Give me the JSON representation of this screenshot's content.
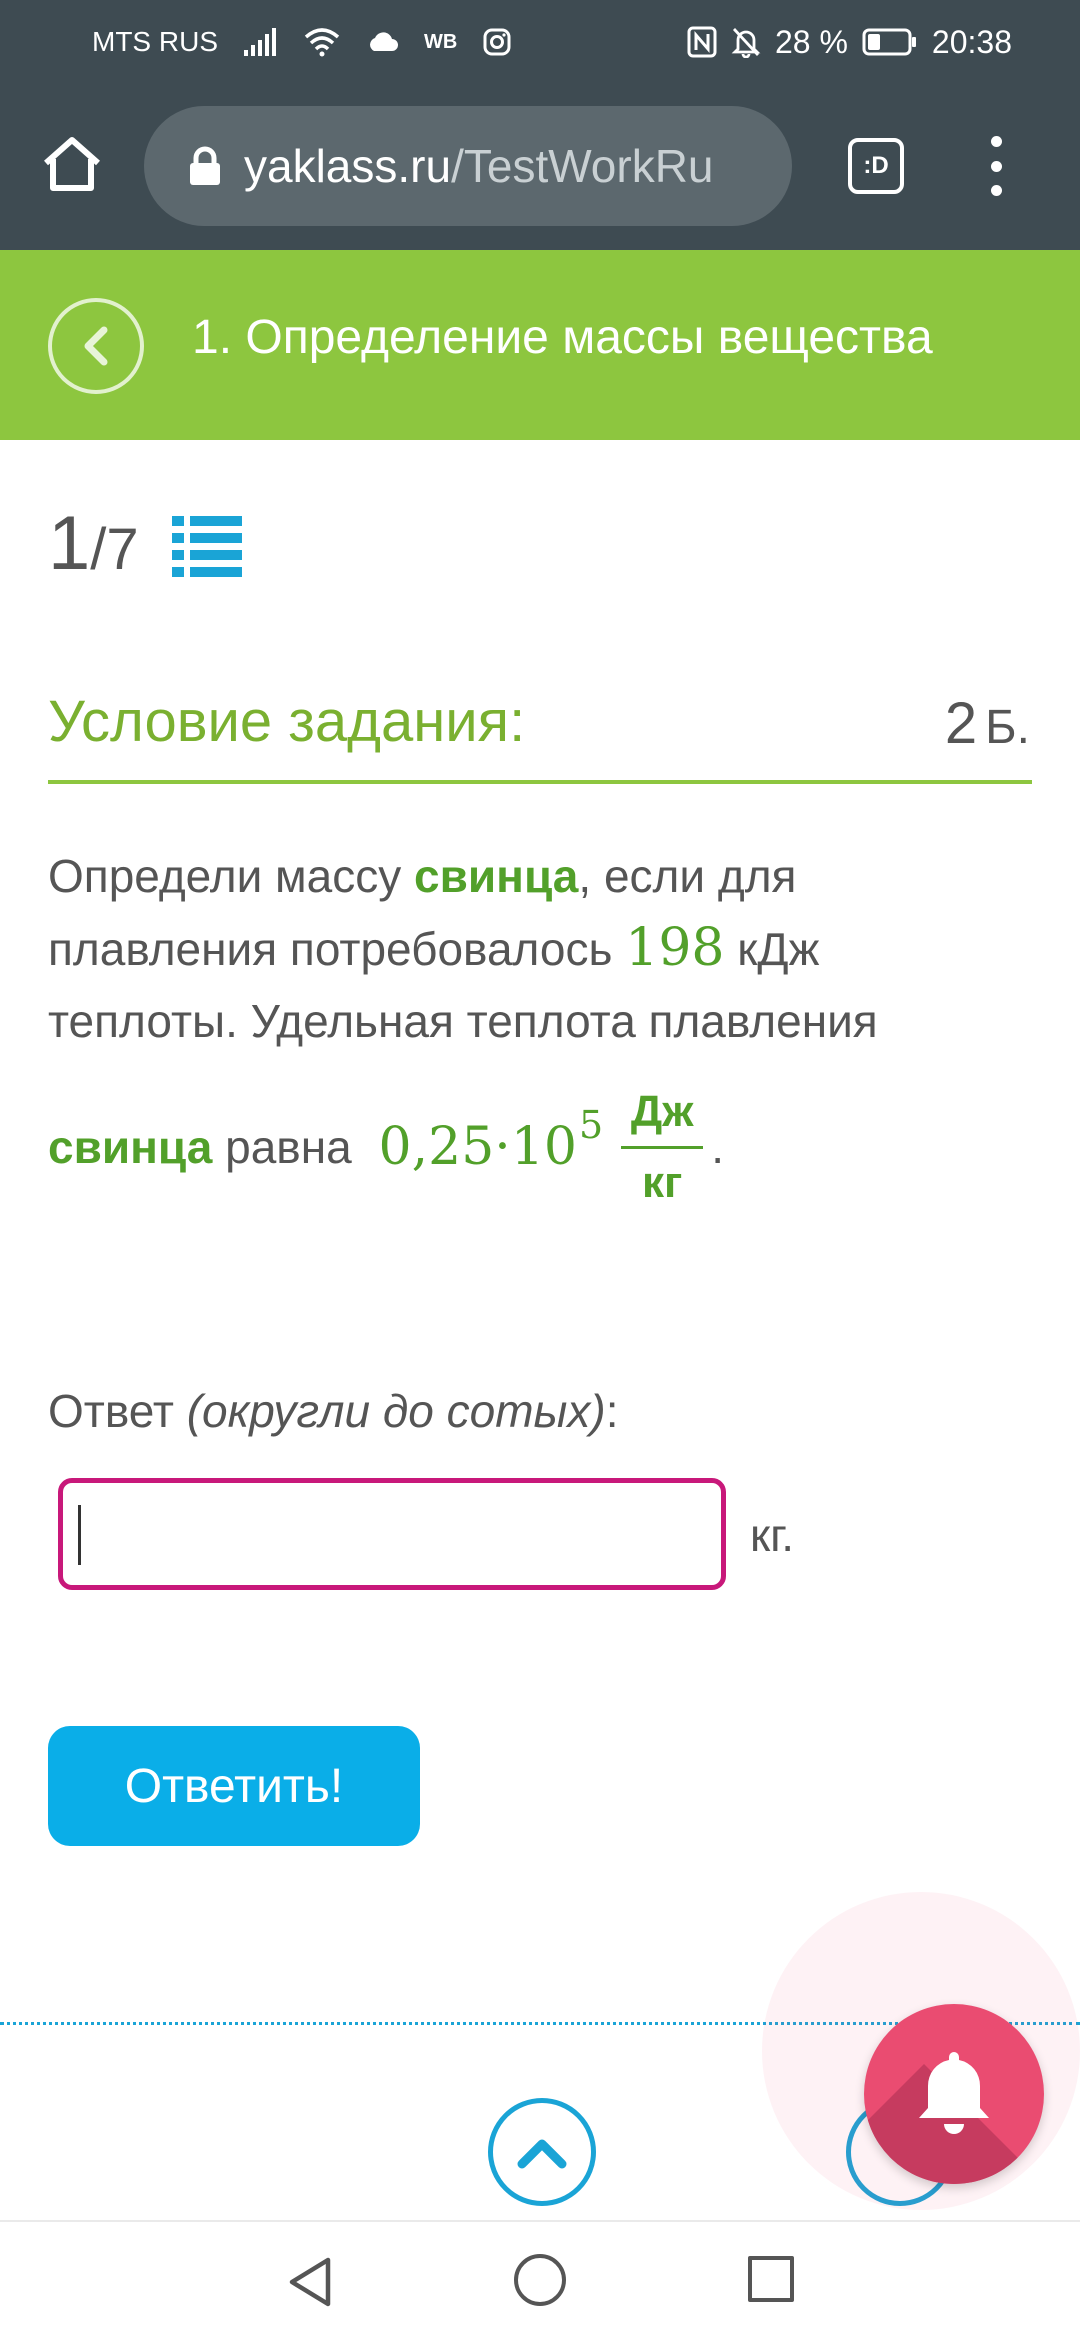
{
  "status_bar": {
    "carrier": "MTS RUS",
    "wb": "WB",
    "battery": "28 %",
    "time": "20:38",
    "icons": [
      "signal-icon",
      "wifi-icon",
      "cloud-icon",
      "instagram-icon",
      "nfc-icon",
      "mute-bell-icon",
      "battery-icon"
    ]
  },
  "browser": {
    "url_host": "yaklass.ru",
    "url_path": "/TestWorkRu",
    "tabs_label": ":D",
    "icons": [
      "home-icon",
      "lock-icon",
      "more-vert-icon"
    ]
  },
  "header": {
    "title": "1. Определение массы вещества",
    "back_icon": "chevron-left-icon",
    "color": "#8dc63f"
  },
  "counter": {
    "current": "1",
    "separator": "/",
    "total": "7",
    "icon": "list-icon"
  },
  "condition": {
    "title": "Условие задания:",
    "points": "2",
    "points_unit": "Б."
  },
  "problem": {
    "p1": "Определи массу ",
    "substance1": "свинца",
    "p2": ", если для плавления потребовалось ",
    "energy": "198",
    "p3": " кДж теплоты. Удельная теплота плавления",
    "substance2": "свинца",
    "p4": " равна ",
    "coef": "0,25·10",
    "exponent": "5",
    "frac_num": "Дж",
    "frac_den": "кг",
    "period": "."
  },
  "answer": {
    "label": "Ответ ",
    "hint": "(округли до сотых)",
    "colon": ":",
    "value": "",
    "unit": "кг."
  },
  "submit_label": "Ответить!",
  "fab": {
    "icon": "bell-icon",
    "color": "#ea4c71"
  },
  "scroll_up_icon": "chevron-up-icon",
  "nav": {
    "icons": [
      "nav-back-icon",
      "nav-home-icon",
      "nav-recent-icon"
    ]
  }
}
